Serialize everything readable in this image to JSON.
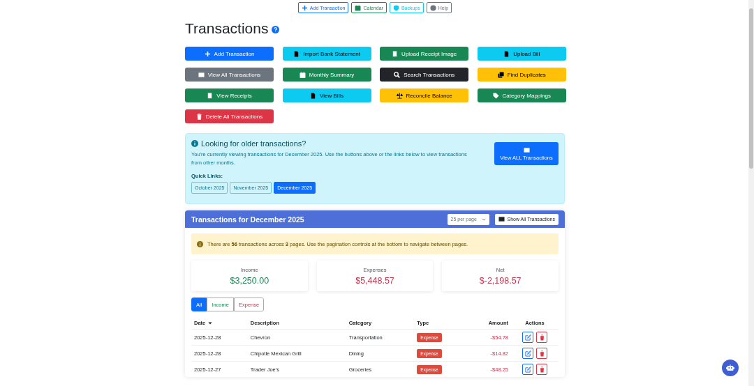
{
  "top_nav": [
    {
      "label": "Add Transaction",
      "kind": "primary"
    },
    {
      "label": "Calendar",
      "kind": "success"
    },
    {
      "label": "Backups",
      "kind": "info"
    },
    {
      "label": "Help",
      "kind": "secondary"
    }
  ],
  "page_title": "Transactions",
  "actions": [
    {
      "label": "Add Transaction",
      "kind": "primary"
    },
    {
      "label": "Import Bank Statement",
      "kind": "info"
    },
    {
      "label": "Upload Receipt Image",
      "kind": "success"
    },
    {
      "label": "Upload Bill",
      "kind": "info"
    },
    {
      "label": "View All Transactions",
      "kind": "secondary"
    },
    {
      "label": "Monthly Summary",
      "kind": "success"
    },
    {
      "label": "Search Transactions",
      "kind": "dark"
    },
    {
      "label": "Find Duplicates",
      "kind": "warning"
    },
    {
      "label": "View Receipts",
      "kind": "success"
    },
    {
      "label": "View Bills",
      "kind": "info"
    },
    {
      "label": "Reconcile Balance",
      "kind": "warning"
    },
    {
      "label": "Category Mappings",
      "kind": "success"
    },
    {
      "label": "Delete All Transactions",
      "kind": "danger"
    }
  ],
  "older_notice": {
    "heading": "Looking for older transactions?",
    "text": "You're currently viewing transactions for December 2025. Use the buttons above or the links below to view transactions from other months.",
    "quick_links_label": "Quick Links:",
    "quick_links": [
      {
        "label": "October 2025",
        "selected": false
      },
      {
        "label": "November 2025",
        "selected": false
      },
      {
        "label": "December 2025",
        "selected": true
      }
    ],
    "button": "View ALL Transactions"
  },
  "card": {
    "title": "Transactions for December 2025",
    "per_page": "25 per page",
    "show_all": "Show All Transactions",
    "alert": "There are **56** transactions across **3** pages. Use the pagination controls at the bottom to navigate between pages.",
    "stats": [
      {
        "label": "Income",
        "value": "$3,250.00",
        "kind": "positive"
      },
      {
        "label": "Expenses",
        "value": "$5,448.57",
        "kind": "negative"
      },
      {
        "label": "Net",
        "value": "$-2,198.57",
        "kind": "negative"
      }
    ],
    "filters": [
      {
        "label": "All",
        "kind": "all",
        "selected": true
      },
      {
        "label": "Income",
        "kind": "income",
        "selected": false
      },
      {
        "label": "Expense",
        "kind": "expense",
        "selected": false
      }
    ],
    "table": {
      "columns": [
        "Date",
        "Description",
        "Category",
        "Type",
        "Amount",
        "Actions"
      ],
      "rows": [
        {
          "date": "2025-12-28",
          "description": "Chevron",
          "category": "Transportation",
          "type": "Expense",
          "kind": "expense",
          "amount": "-$54.78"
        },
        {
          "date": "2025-12-28",
          "description": "Chipotle Mexican Grill",
          "category": "Dining",
          "type": "Expense",
          "kind": "expense",
          "amount": "-$14.82"
        },
        {
          "date": "2025-12-27",
          "description": "Trader Joe's",
          "category": "Groceries",
          "type": "Expense",
          "kind": "expense",
          "amount": "-$48.25"
        }
      ]
    }
  }
}
